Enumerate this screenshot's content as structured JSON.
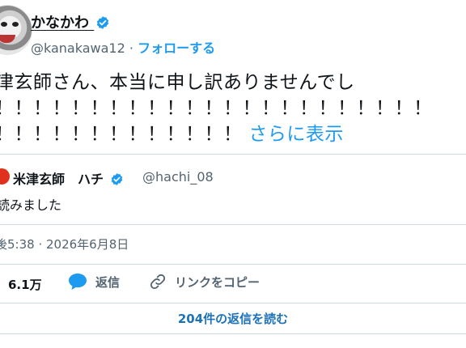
{
  "author": {
    "display_name": "かなかわ",
    "handle": "@kanakawa12",
    "separator": "·",
    "follow_label": "フォローする"
  },
  "tweet": {
    "line1": "津玄師さん、本当に申し訳ありませんでし",
    "line2": "！！！！！！！！！！！！！！！！！！！！！！！",
    "line3": "！！！！！！！！！！！！！",
    "show_more": "さらに表示"
  },
  "quote": {
    "name": "米津玄師　ハチ",
    "handle": "@hachi_08",
    "text": "読みました"
  },
  "timestamp": "後5:38 · 2026年6月8日",
  "actions": {
    "like_count": "6.1万",
    "reply_label": "返信",
    "copy_link_label": "リンクをコピー"
  },
  "read_replies_label": "204件の返信を読む",
  "colors": {
    "accent": "#1d9bf0",
    "text": "#0f1419",
    "muted": "#536471",
    "border": "#cfd9de"
  },
  "icons": [
    "verified-badge-icon",
    "reply-bubble-icon",
    "link-icon"
  ]
}
